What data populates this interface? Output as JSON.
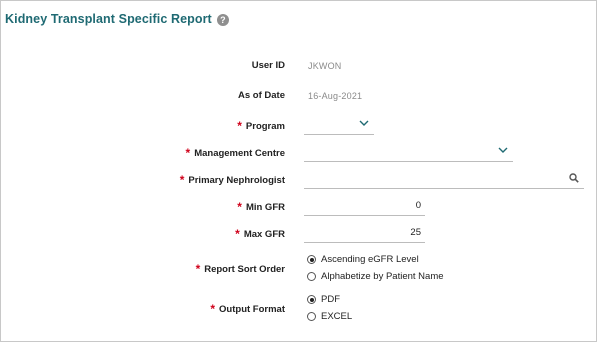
{
  "report": {
    "title": "Kidney Transplant Specific Report",
    "help_icon": "?"
  },
  "fields": {
    "user_id": {
      "label": "User ID",
      "value": "JKWON"
    },
    "as_of_date": {
      "label": "As of Date",
      "value": "16-Aug-2021"
    },
    "program": {
      "label": "Program",
      "required_mark": "*",
      "value": ""
    },
    "management_centre": {
      "label": "Management Centre",
      "required_mark": "*",
      "value": ""
    },
    "primary_nephrologist": {
      "label": "Primary Nephrologist",
      "required_mark": "*",
      "value": ""
    },
    "min_gfr": {
      "label": "Min GFR",
      "required_mark": "*",
      "value": "0"
    },
    "max_gfr": {
      "label": "Max GFR",
      "required_mark": "*",
      "value": "25"
    },
    "report_sort_order": {
      "label": "Report Sort Order",
      "required_mark": "*",
      "options": [
        "Ascending eGFR Level",
        "Alphabetize by Patient Name"
      ],
      "selected": 0
    },
    "output_format": {
      "label": "Output Format",
      "required_mark": "*",
      "options": [
        "PDF",
        "EXCEL"
      ],
      "selected": 0
    }
  },
  "icons": {
    "dropdown": "chevron-down-icon",
    "search": "search-icon",
    "help": "help-icon"
  },
  "colors": {
    "title": "#1f6a73",
    "required": "#d0021b",
    "chevron": "#1f6a73",
    "readonly_value": "#8a8a8a"
  }
}
